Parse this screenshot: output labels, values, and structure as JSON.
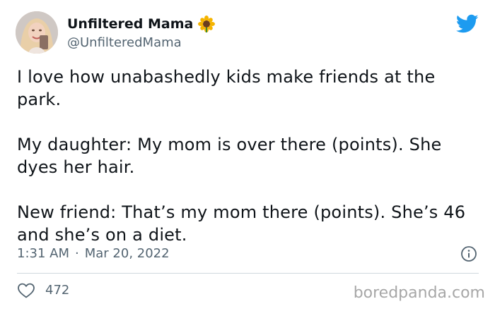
{
  "author": {
    "display_name": "Unfiltered Mama",
    "handle": "@UnfilteredMama"
  },
  "tweet": {
    "paragraphs": [
      "I love how unabashedly kids make friends at the park.",
      "My daughter: My mom is over there (points). She dyes her hair.",
      "New friend: That’s my mom there (points). She’s 46 and she’s on a diet."
    ],
    "time": "1:31 AM",
    "separator": "·",
    "date": "Mar 20, 2022"
  },
  "stats": {
    "likes": "472"
  },
  "watermark": "boredpanda.com",
  "icons": {
    "brand": "twitter-bird-icon",
    "emoji": "sunflower-icon",
    "info": "info-icon",
    "like": "heart-icon"
  },
  "colors": {
    "twitter_blue": "#1d9bf0",
    "text": "#0f1419",
    "secondary": "#536471",
    "divider": "#cfd9de",
    "watermark": "#a7a7a7"
  }
}
